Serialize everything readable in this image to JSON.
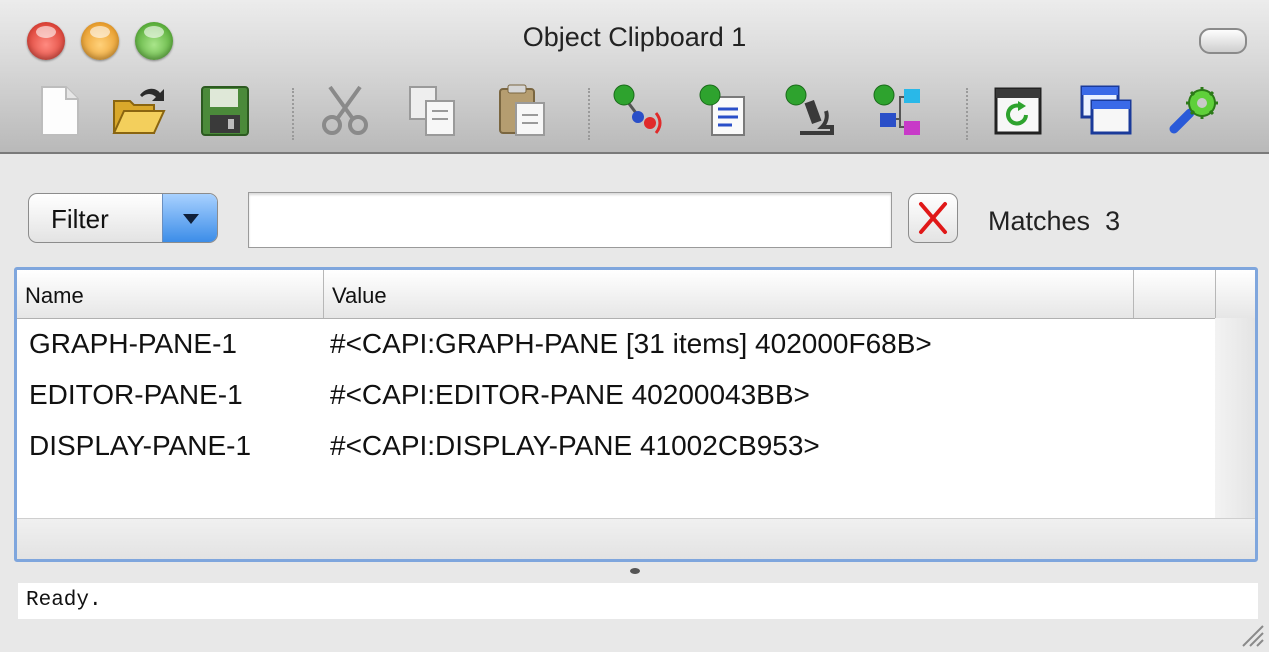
{
  "window": {
    "title": "Object Clipboard 1"
  },
  "toolbar": {
    "items": [
      {
        "name": "new-document-icon"
      },
      {
        "name": "open-folder-icon"
      },
      {
        "name": "save-icon"
      },
      {
        "name": "cut-icon"
      },
      {
        "name": "copy-icon"
      },
      {
        "name": "paste-icon"
      },
      {
        "name": "inspect-broadcast-icon"
      },
      {
        "name": "inspect-document-icon"
      },
      {
        "name": "inspect-microscope-icon"
      },
      {
        "name": "inspect-graph-icon"
      },
      {
        "name": "refresh-window-icon"
      },
      {
        "name": "new-window-icon"
      },
      {
        "name": "preferences-icon"
      }
    ]
  },
  "filter": {
    "button_label": "Filter",
    "input_value": "",
    "matches_label": "Matches",
    "matches_count": "3"
  },
  "table": {
    "columns": [
      "Name",
      "Value"
    ],
    "rows": [
      {
        "name": "GRAPH-PANE-1",
        "value": "#<CAPI:GRAPH-PANE [31 items] 402000F68B>"
      },
      {
        "name": "EDITOR-PANE-1",
        "value": "#<CAPI:EDITOR-PANE  40200043BB>"
      },
      {
        "name": "DISPLAY-PANE-1",
        "value": "#<CAPI:DISPLAY-PANE  41002CB953>"
      }
    ]
  },
  "status": {
    "text": "Ready."
  }
}
